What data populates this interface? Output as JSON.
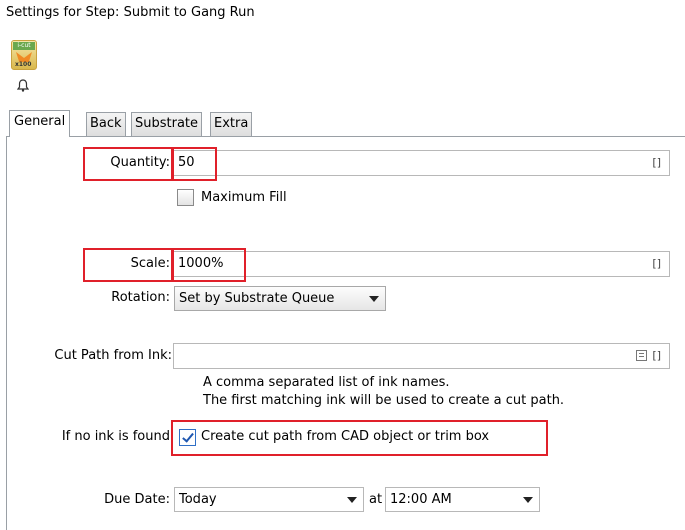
{
  "window": {
    "title": "Settings for Step: Submit to Gang Run"
  },
  "icons": {
    "app": "icut-app-icon",
    "bell": "bell-icon",
    "app_tag": "i-cut",
    "app_num": "x100"
  },
  "tabs": [
    {
      "label": "General",
      "active": true
    },
    {
      "label": "Back",
      "active": false
    },
    {
      "label": "Substrate",
      "active": false
    },
    {
      "label": "Extra",
      "active": false
    }
  ],
  "general": {
    "quantity": {
      "label": "Quantity:",
      "value": "50",
      "icon": "[]"
    },
    "maximum_fill": {
      "label": "Maximum Fill",
      "checked": false
    },
    "scale": {
      "label": "Scale:",
      "value": "1000%",
      "icon": "[]"
    },
    "rotation": {
      "label": "Rotation:",
      "selected": "Set by Substrate Queue"
    },
    "cut_path": {
      "label": "Cut Path from Ink:",
      "value": "",
      "icons": [
        "list-icon",
        "bracket-icon"
      ],
      "icon_bracket": "[]",
      "help_line1": "A comma separated list of ink names.",
      "help_line2": "The first matching ink will be used to create a cut path."
    },
    "no_ink": {
      "label": "If no ink is found",
      "checkbox_label": "Create cut path from CAD object or trim box",
      "checked": true
    },
    "due_date": {
      "label": "Due Date:",
      "date": "Today",
      "at": "at",
      "time": "12:00 AM"
    }
  },
  "colors": {
    "highlight": "#e0202a",
    "check": "#1f57b0"
  }
}
